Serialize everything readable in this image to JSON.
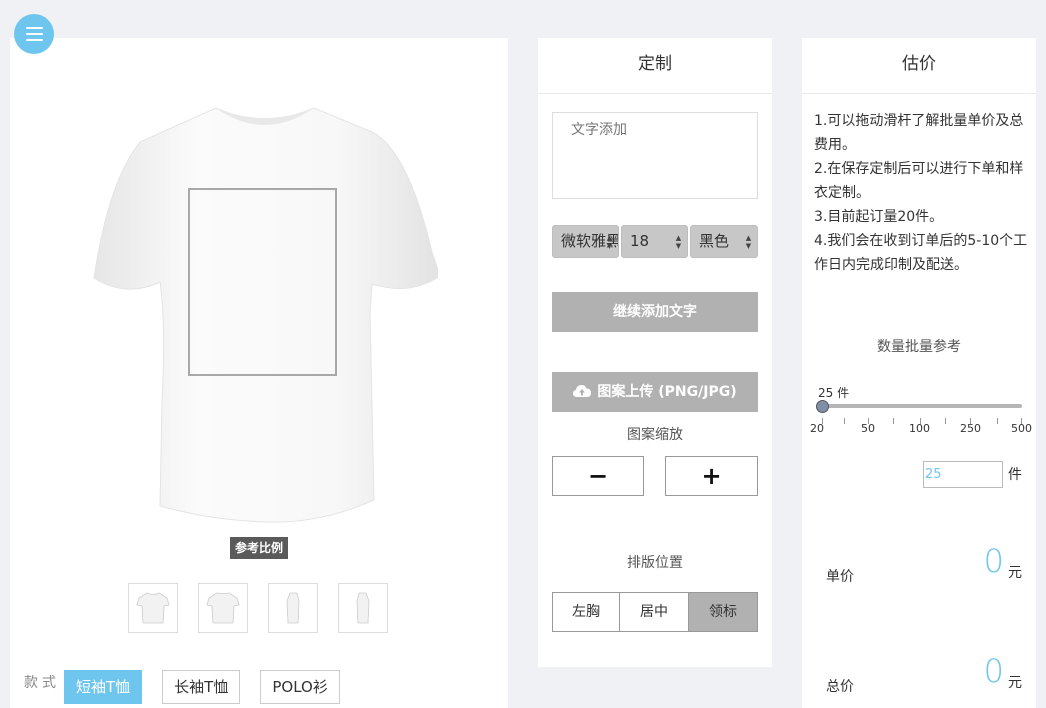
{
  "nav": {
    "menu_icon": "hamburger-menu-icon"
  },
  "preview": {
    "ref_label": "参考比例",
    "thumbnails": [
      "front-view",
      "back-view",
      "left-side-view",
      "right-side-view"
    ],
    "style_label": "款式",
    "styles": [
      {
        "label": "短袖T恤",
        "active": true
      },
      {
        "label": "长袖T恤",
        "active": false
      },
      {
        "label": "POLO衫",
        "active": false
      }
    ]
  },
  "customize": {
    "title": "定制",
    "text_placeholder": "文字添加",
    "font_select": "微软雅黑",
    "size_select": "18",
    "color_select": "黑色",
    "add_text_btn": "继续添加文字",
    "upload_btn": "图案上传 (PNG/JPG)",
    "scale_label": "图案缩放",
    "minus": "−",
    "plus": "+",
    "position_label": "排版位置",
    "positions": [
      {
        "label": "左胸",
        "active": false
      },
      {
        "label": "居中",
        "active": false
      },
      {
        "label": "领标",
        "active": true
      }
    ]
  },
  "estimate": {
    "title": "估价",
    "notes": [
      "1.可以拖动滑杆了解批量单价及总费用。",
      "2.在保存定制后可以进行下单和样衣定制。",
      "3.目前起订量20件。",
      "4.我们会在收到订单后的5-10个工作日内完成印制及配送。"
    ],
    "qty_label": "数量批量参考",
    "slider_value": "25 件",
    "ticks": [
      "20",
      "50",
      "100",
      "250",
      "500"
    ],
    "qty_input": "25",
    "qty_unit": "件",
    "unit_price_label": "单价",
    "unit_price": "0",
    "total_price_label": "总价",
    "total_price": "0",
    "currency": "元"
  },
  "colors": {
    "accent": "#6ec6ef",
    "gray_btn": "#b1b1b1",
    "bg": "#f0f1f5"
  }
}
